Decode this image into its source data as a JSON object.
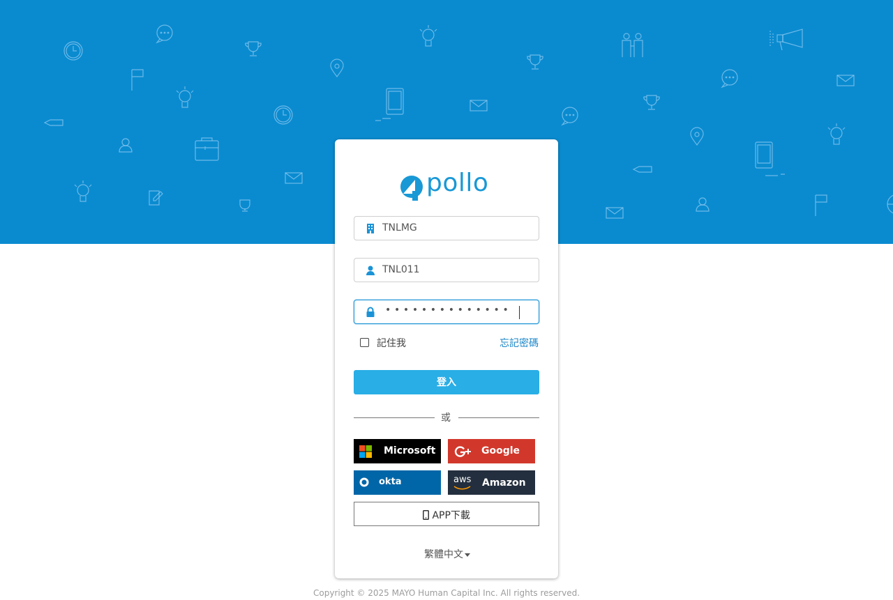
{
  "brand": {
    "logo_text": "pollo"
  },
  "login": {
    "company_value": "TNLMG",
    "username_value": "TNL011",
    "password_mask": "••••••••••••••",
    "remember_label": "記住我",
    "forgot_label": "忘記密碼",
    "login_label": "登入",
    "or_label": "或"
  },
  "sso": {
    "microsoft_label": "Microsoft",
    "google_label": "Google",
    "okta_label": "okta",
    "amazon_label": "Amazon",
    "amazon_icon_text": "aws"
  },
  "app_download_label": "APP下載",
  "language": {
    "selected": "繁體中文"
  },
  "footer": {
    "copyright": "Copyright © 2025 MAYO Human Capital Inc. All rights reserved."
  },
  "colors": {
    "banner": "#0a8bd0",
    "accent": "#29aee6",
    "link": "#1a86c8",
    "microsoft": "#000000",
    "google": "#d1382b",
    "okta": "#0066a8",
    "amazon": "#232f3e"
  },
  "icons": {
    "company": "building-icon",
    "user": "user-icon",
    "password": "lock-icon",
    "app": "mobile-phone-icon",
    "language": "caret-down-icon"
  }
}
